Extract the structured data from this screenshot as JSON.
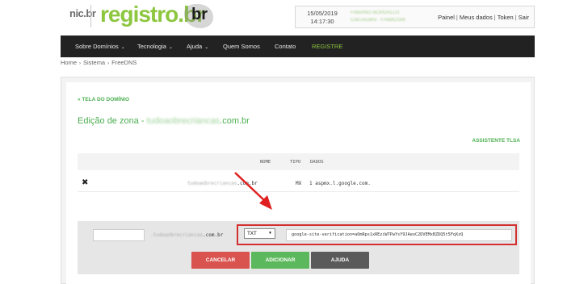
{
  "header": {
    "logo_nic": "nic.br",
    "logo_registro": "registro.br",
    "logo_br": "br",
    "date": "15/05/2019",
    "time": "14:17:30",
    "user_name_blurred": "FABIANO BORDALLO",
    "user_sub_blurred": "Cód.usuário · FABBO168",
    "links": [
      "Painel",
      "Meus dados",
      "Token",
      "Sair"
    ]
  },
  "nav": {
    "items": [
      {
        "label": "Sobre Domínios",
        "caret": "⌄"
      },
      {
        "label": "Tecnologia",
        "caret": "⌄"
      },
      {
        "label": "Ajuda",
        "caret": "⌄"
      },
      {
        "label": "Quem Somos",
        "caret": ""
      },
      {
        "label": "Contato",
        "caret": ""
      },
      {
        "label": "REGISTRE",
        "caret": ""
      }
    ]
  },
  "breadcrumb": [
    "Home",
    "Sistema",
    "FreeDNS"
  ],
  "main": {
    "back_link": "« TELA DO DOMÍNIO",
    "zone_title_prefix": "Edição de zona - ",
    "zone_domain_blurred": "tudoaobrecriancas",
    "zone_domain_suffix": ".com.br",
    "tlsa_link": "ASSISTENTE TLSA",
    "table": {
      "headers": [
        "NOME",
        "TIPO",
        "DADOS"
      ],
      "rows": [
        {
          "delete_icon": "✖",
          "name_blurred": "tudoaobrecriancas",
          "name_suffix": ".com.br",
          "type": "MX",
          "data": "1 aspmx.l.google.com."
        }
      ]
    },
    "form": {
      "name_value": "",
      "domain_suffix_blurred": ".tudoaobrecriancas",
      "domain_suffix": ".com.br",
      "type_value": "TXT",
      "record_value": "google-site-verification=aOmRps1xREziW7PwYsY9JAeoC2DVEMxBZDQ5t5FqXzQ",
      "buttons": {
        "cancel": "CANCELAR",
        "add": "ADICIONAR",
        "help": "AJUDA"
      }
    }
  },
  "colors": {
    "brand_green": "#8dc63f",
    "link_green": "#4caf50",
    "nav_bg": "#222222",
    "highlight_red": "#d32f2f",
    "cancel_btn": "#d9534f",
    "add_btn": "#5cb85c",
    "help_btn": "#5a5a5a"
  },
  "icons": {
    "delete": "close-x-icon",
    "annotation_arrow": "red-arrow-icon"
  }
}
